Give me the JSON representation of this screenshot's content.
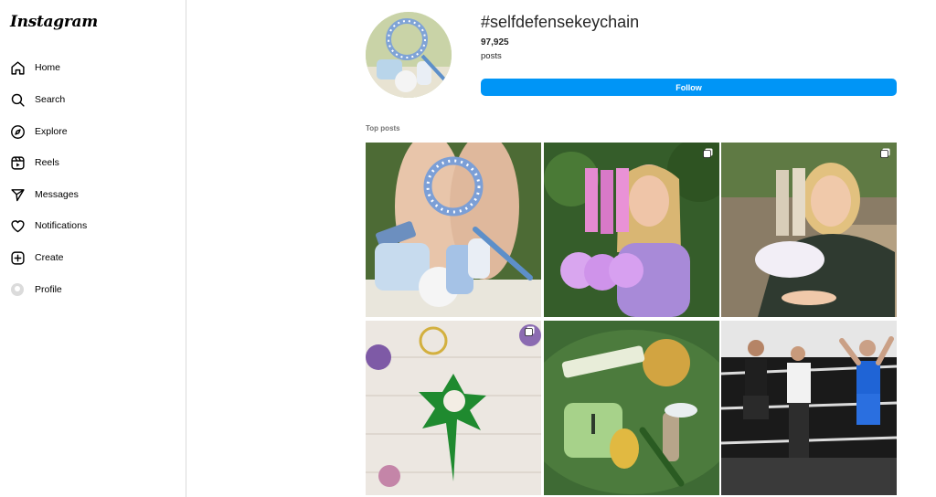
{
  "app": {
    "logo": "Instagram"
  },
  "sidebar": {
    "items": [
      {
        "label": "Home",
        "icon": "home-icon"
      },
      {
        "label": "Search",
        "icon": "search-icon"
      },
      {
        "label": "Explore",
        "icon": "compass-icon"
      },
      {
        "label": "Reels",
        "icon": "reels-icon"
      },
      {
        "label": "Messages",
        "icon": "send-icon"
      },
      {
        "label": "Notifications",
        "icon": "heart-icon"
      },
      {
        "label": "Create",
        "icon": "plus-square-icon"
      },
      {
        "label": "Profile",
        "icon": "avatar"
      }
    ]
  },
  "header": {
    "hashtag": "#selfdefensekeychain",
    "post_count": "97,925",
    "posts_label": "posts",
    "follow_label": "Follow"
  },
  "top_posts": {
    "title": "Top posts",
    "posts": [
      {
        "subject": "blue bracelet keychain with alarm and pom pom",
        "multi": false
      },
      {
        "subject": "woman holding pink wristlet keychains",
        "multi": true
      },
      {
        "subject": "woman holding beige wristlet keychains",
        "multi": true
      },
      {
        "subject": "green glitter star keychain",
        "multi": true
      },
      {
        "subject": "green keychain set with yellow pom pom",
        "multi": false
      },
      {
        "subject": "boxing match in ring",
        "multi": false
      }
    ]
  },
  "colors": {
    "accent": "#0095f6",
    "border": "#dbdbdb",
    "muted": "#737373"
  }
}
